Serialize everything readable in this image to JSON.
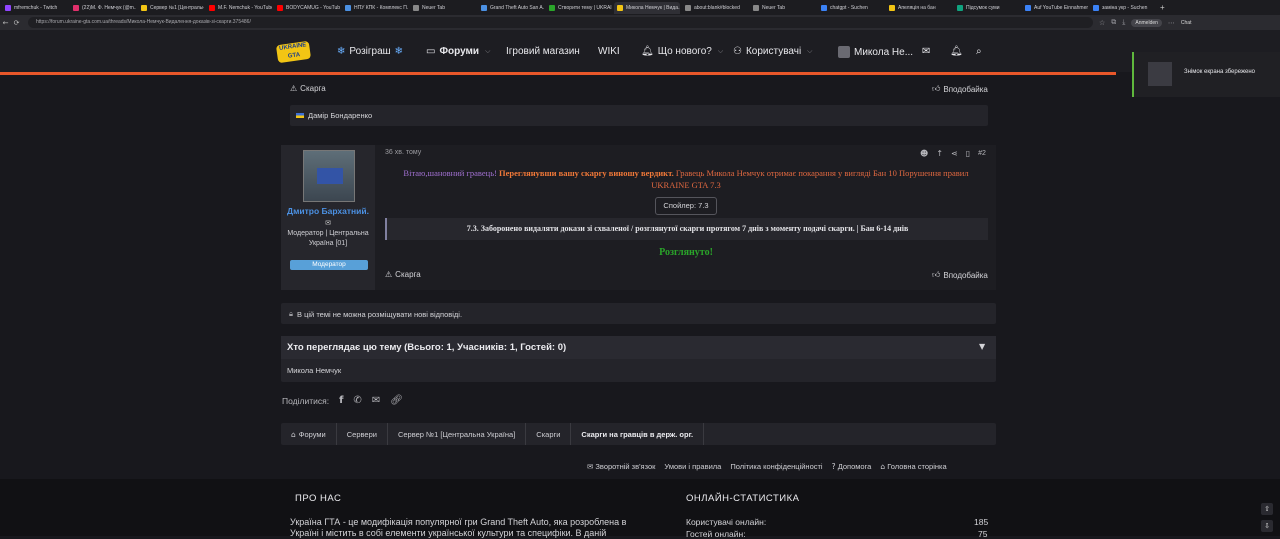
{
  "browser": {
    "tabs": [
      {
        "title": "mfremchuk - Twitch",
        "color": "#9146ff"
      },
      {
        "title": "(22)M. Ф. Немчук (@m...",
        "color": "#e1306c"
      },
      {
        "title": "Сервер №1 [Центральна...",
        "color": "#f2c514"
      },
      {
        "title": "M.F. Nemchuk - YouTube",
        "color": "#ff0000"
      },
      {
        "title": "BODYCAMUG - YouTube",
        "color": "#ff0000"
      },
      {
        "title": "НПУ КПК - Комплекс П...",
        "color": "#4b90e2"
      },
      {
        "title": "Neuer Tab",
        "color": "#888888"
      },
      {
        "title": "Grand Theft Auto San A...",
        "color": "#4b90e2"
      },
      {
        "title": "Створити тему | UKRAI...",
        "color": "#2aa52a"
      },
      {
        "title": "Микола Немчук | Вида...",
        "color": "#f2c514"
      },
      {
        "title": "about:blank#blocked",
        "color": "#888888"
      },
      {
        "title": "Neuer Tab",
        "color": "#888888"
      },
      {
        "title": "chatgpt - Suchen",
        "color": "#3b82f6"
      },
      {
        "title": "Апеляція на бан",
        "color": "#f2c514"
      },
      {
        "title": "Підсумок суми",
        "color": "#10a37f"
      },
      {
        "title": "Auf YouTube Einnahmen",
        "color": "#3b82f6"
      },
      {
        "title": "заміна укр - Suchen",
        "color": "#3b82f6"
      }
    ],
    "active_tab": 9,
    "url": "https://forum.ukraine-gta.com.ua/threads/Микола-Немчук-Видалення-доказів-зі-скарги.375486/",
    "profile_label": "Anmelden",
    "chat_label": "Chat"
  },
  "header": {
    "logo_text": "UKRAINE GTA",
    "nav": {
      "giveaway": "Розіграш",
      "forums": "Форуми",
      "shop": "Ігровий магазин",
      "wiki": "WIKI",
      "whats_new": "Що нового?",
      "users": "Користувачі",
      "username": "Микола Не..."
    }
  },
  "notification": {
    "text": "Знімок екрана збережено"
  },
  "prev_post": {
    "report": "Скарга",
    "like": "Вподобайка",
    "reactor": "Дамір Бондаренко"
  },
  "post": {
    "time": "36 хв. тому",
    "number": "#2",
    "author": {
      "name": "Дмитро Бархатний.",
      "role": "Модератор | Центральна Україна [01]",
      "badge": "Модератор"
    },
    "greeting": "Вітаю,шановний гравець!",
    "verdict_bold": "Переглянувши вашу скаргу виношу вердикт.",
    "verdict_rest": "Гравець Микола Немчук отримає покарання у вигляді Бан 10 Порушення правил UKRAINE GTA 7.3",
    "spoiler": "Спойлер: 7.3",
    "quote": "7.3. Заборонено видаляти докази зі схваленої / розглянутої скарги протягом 7 днів з моменту подачі скарги. | Бан 6-14 днів",
    "reviewed": "Розглянуто!",
    "report": "Скарга",
    "like": "Вподобайка"
  },
  "locked_notice": "В цій темі не можна розміщувати нові відповіді.",
  "viewers": {
    "title": "Хто переглядає цю тему (Всього: 1, Учасників: 1, Гостей: 0)",
    "list": "Микола Немчук"
  },
  "share": {
    "label": "Поділитися:"
  },
  "breadcrumbs": [
    "Форуми",
    "Сервери",
    "Сервер №1 [Центральна Україна]",
    "Скарги",
    "Скарги на гравців в держ. орг."
  ],
  "footer_links": [
    "Зворотній зв'язок",
    "Умови і правила",
    "Політика конфіденційності",
    "Допомога",
    "Головна сторінка"
  ],
  "footer": {
    "about_title": "ПРО НАС",
    "about_text": "Україна ГТА - це модифікація популярної гри Grand Theft Auto, яка розроблена в Україні і містить в собі елементи української культури та специфіки. В даній",
    "stats_title": "ОНЛАЙН-СТАТИСТИКА",
    "stats": [
      {
        "label": "Користувачі онлайн:",
        "value": "185"
      },
      {
        "label": "Гостей онлайн:",
        "value": "75"
      }
    ]
  }
}
